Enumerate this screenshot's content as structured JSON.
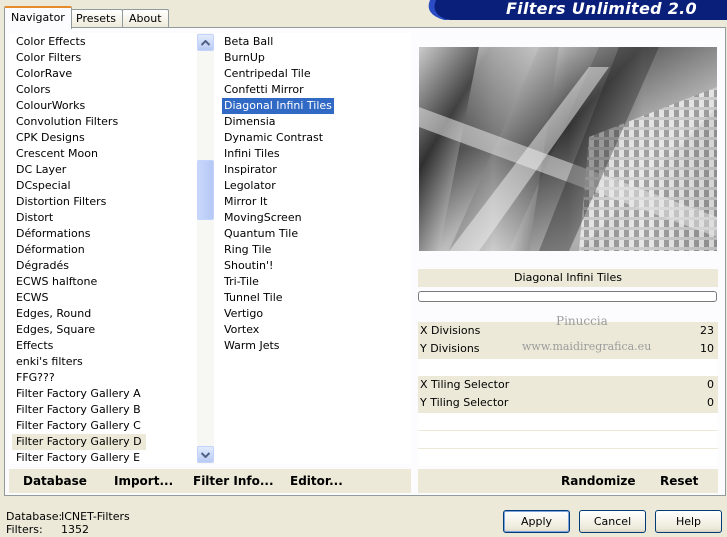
{
  "app": {
    "title": "Filters Unlimited 2.0"
  },
  "tabs": [
    {
      "label": "Navigator",
      "active": true
    },
    {
      "label": "Presets",
      "active": false
    },
    {
      "label": "About",
      "active": false
    }
  ],
  "categories": {
    "items": [
      "Color Effects",
      "Color Filters",
      "ColorRave",
      "Colors",
      "ColourWorks",
      "Convolution Filters",
      "CPK Designs",
      "Crescent Moon",
      "DC Layer",
      "DCspecial",
      "Distortion Filters",
      "Distort",
      "Déformations",
      "Déformation",
      "Dégradés",
      "ECWS halftone",
      "ECWS",
      "Edges, Round",
      "Edges, Square",
      "Effects",
      "enki's filters",
      "FFG???",
      "Filter Factory Gallery A",
      "Filter Factory Gallery B",
      "Filter Factory Gallery C",
      "Filter Factory Gallery D",
      "Filter Factory Gallery E"
    ],
    "selected": "Filter Factory Gallery D"
  },
  "filters": {
    "items": [
      "Beta Ball",
      "BurnUp",
      "Centripedal Tile",
      "Confetti Mirror",
      "Diagonal Infini Tiles",
      "Dimensia",
      "Dynamic Contrast",
      "Infini Tiles",
      "Inspirator",
      "Legolator",
      "Mirror It",
      "MovingScreen",
      "Quantum Tile",
      "Ring Tile",
      "Shoutin'!",
      "Tri-Tile",
      "Tunnel Tile",
      "Vertigo",
      "Vortex",
      "Warm Jets"
    ],
    "selected": "Diagonal Infini Tiles"
  },
  "selected_filter_name": "Diagonal Infini Tiles",
  "params": [
    {
      "label": "X Divisions",
      "value": "23"
    },
    {
      "label": "Y Divisions",
      "value": "10"
    },
    {
      "label": "X Tiling Selector",
      "value": "0"
    },
    {
      "label": "Y Tiling Selector",
      "value": "0"
    }
  ],
  "watermark": {
    "line1": "Pinuccia",
    "line2": "www.maidiregrafica.eu"
  },
  "toolbar": {
    "database": "Database",
    "import": "Import...",
    "filter_info": "Filter Info...",
    "editor": "Editor...",
    "randomize": "Randomize",
    "reset": "Reset"
  },
  "status": {
    "database_label": "Database:",
    "database_value": "ICNET-Filters",
    "filters_label": "Filters:",
    "filters_value": "1352"
  },
  "buttons": {
    "apply": "Apply",
    "cancel": "Cancel",
    "help": "Help"
  },
  "colors": {
    "banner": "#0a1f7a",
    "selection": "#316ac5",
    "tab_highlight": "#e68b2c"
  }
}
